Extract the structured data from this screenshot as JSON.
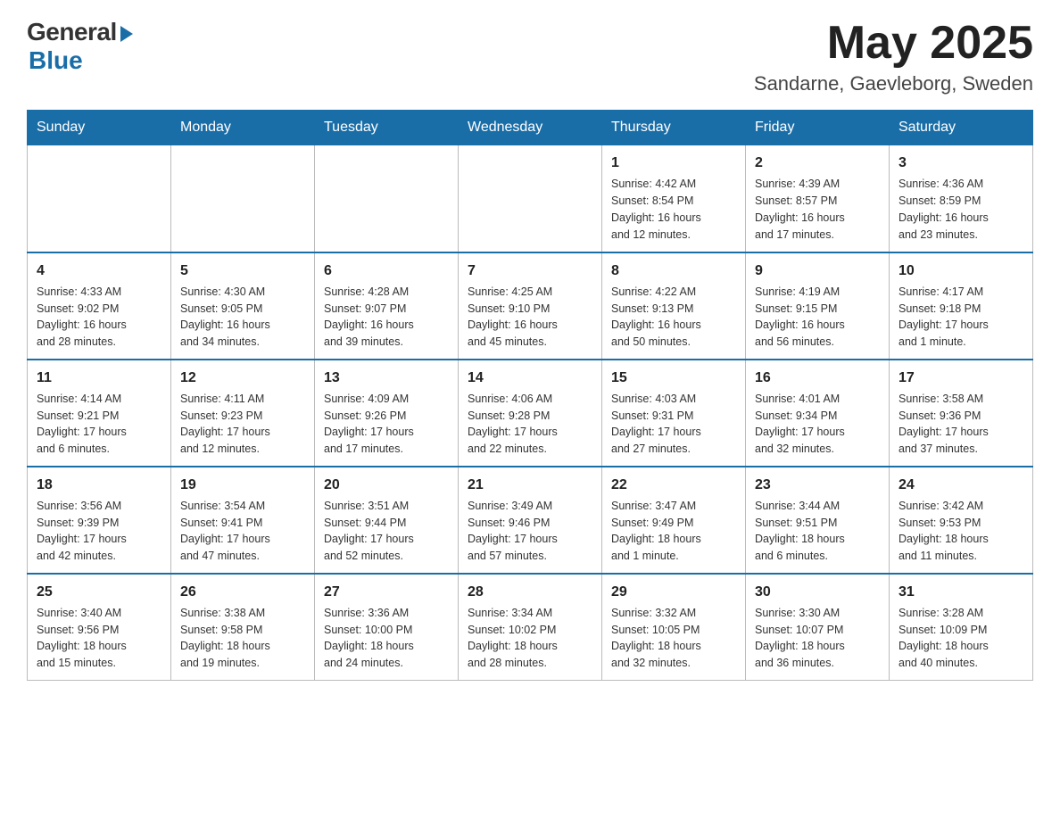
{
  "header": {
    "logo_general": "General",
    "logo_blue": "Blue",
    "month_year": "May 2025",
    "location": "Sandarne, Gaevleborg, Sweden"
  },
  "weekdays": [
    "Sunday",
    "Monday",
    "Tuesday",
    "Wednesday",
    "Thursday",
    "Friday",
    "Saturday"
  ],
  "weeks": [
    [
      {
        "day": "",
        "info": ""
      },
      {
        "day": "",
        "info": ""
      },
      {
        "day": "",
        "info": ""
      },
      {
        "day": "",
        "info": ""
      },
      {
        "day": "1",
        "info": "Sunrise: 4:42 AM\nSunset: 8:54 PM\nDaylight: 16 hours\nand 12 minutes."
      },
      {
        "day": "2",
        "info": "Sunrise: 4:39 AM\nSunset: 8:57 PM\nDaylight: 16 hours\nand 17 minutes."
      },
      {
        "day": "3",
        "info": "Sunrise: 4:36 AM\nSunset: 8:59 PM\nDaylight: 16 hours\nand 23 minutes."
      }
    ],
    [
      {
        "day": "4",
        "info": "Sunrise: 4:33 AM\nSunset: 9:02 PM\nDaylight: 16 hours\nand 28 minutes."
      },
      {
        "day": "5",
        "info": "Sunrise: 4:30 AM\nSunset: 9:05 PM\nDaylight: 16 hours\nand 34 minutes."
      },
      {
        "day": "6",
        "info": "Sunrise: 4:28 AM\nSunset: 9:07 PM\nDaylight: 16 hours\nand 39 minutes."
      },
      {
        "day": "7",
        "info": "Sunrise: 4:25 AM\nSunset: 9:10 PM\nDaylight: 16 hours\nand 45 minutes."
      },
      {
        "day": "8",
        "info": "Sunrise: 4:22 AM\nSunset: 9:13 PM\nDaylight: 16 hours\nand 50 minutes."
      },
      {
        "day": "9",
        "info": "Sunrise: 4:19 AM\nSunset: 9:15 PM\nDaylight: 16 hours\nand 56 minutes."
      },
      {
        "day": "10",
        "info": "Sunrise: 4:17 AM\nSunset: 9:18 PM\nDaylight: 17 hours\nand 1 minute."
      }
    ],
    [
      {
        "day": "11",
        "info": "Sunrise: 4:14 AM\nSunset: 9:21 PM\nDaylight: 17 hours\nand 6 minutes."
      },
      {
        "day": "12",
        "info": "Sunrise: 4:11 AM\nSunset: 9:23 PM\nDaylight: 17 hours\nand 12 minutes."
      },
      {
        "day": "13",
        "info": "Sunrise: 4:09 AM\nSunset: 9:26 PM\nDaylight: 17 hours\nand 17 minutes."
      },
      {
        "day": "14",
        "info": "Sunrise: 4:06 AM\nSunset: 9:28 PM\nDaylight: 17 hours\nand 22 minutes."
      },
      {
        "day": "15",
        "info": "Sunrise: 4:03 AM\nSunset: 9:31 PM\nDaylight: 17 hours\nand 27 minutes."
      },
      {
        "day": "16",
        "info": "Sunrise: 4:01 AM\nSunset: 9:34 PM\nDaylight: 17 hours\nand 32 minutes."
      },
      {
        "day": "17",
        "info": "Sunrise: 3:58 AM\nSunset: 9:36 PM\nDaylight: 17 hours\nand 37 minutes."
      }
    ],
    [
      {
        "day": "18",
        "info": "Sunrise: 3:56 AM\nSunset: 9:39 PM\nDaylight: 17 hours\nand 42 minutes."
      },
      {
        "day": "19",
        "info": "Sunrise: 3:54 AM\nSunset: 9:41 PM\nDaylight: 17 hours\nand 47 minutes."
      },
      {
        "day": "20",
        "info": "Sunrise: 3:51 AM\nSunset: 9:44 PM\nDaylight: 17 hours\nand 52 minutes."
      },
      {
        "day": "21",
        "info": "Sunrise: 3:49 AM\nSunset: 9:46 PM\nDaylight: 17 hours\nand 57 minutes."
      },
      {
        "day": "22",
        "info": "Sunrise: 3:47 AM\nSunset: 9:49 PM\nDaylight: 18 hours\nand 1 minute."
      },
      {
        "day": "23",
        "info": "Sunrise: 3:44 AM\nSunset: 9:51 PM\nDaylight: 18 hours\nand 6 minutes."
      },
      {
        "day": "24",
        "info": "Sunrise: 3:42 AM\nSunset: 9:53 PM\nDaylight: 18 hours\nand 11 minutes."
      }
    ],
    [
      {
        "day": "25",
        "info": "Sunrise: 3:40 AM\nSunset: 9:56 PM\nDaylight: 18 hours\nand 15 minutes."
      },
      {
        "day": "26",
        "info": "Sunrise: 3:38 AM\nSunset: 9:58 PM\nDaylight: 18 hours\nand 19 minutes."
      },
      {
        "day": "27",
        "info": "Sunrise: 3:36 AM\nSunset: 10:00 PM\nDaylight: 18 hours\nand 24 minutes."
      },
      {
        "day": "28",
        "info": "Sunrise: 3:34 AM\nSunset: 10:02 PM\nDaylight: 18 hours\nand 28 minutes."
      },
      {
        "day": "29",
        "info": "Sunrise: 3:32 AM\nSunset: 10:05 PM\nDaylight: 18 hours\nand 32 minutes."
      },
      {
        "day": "30",
        "info": "Sunrise: 3:30 AM\nSunset: 10:07 PM\nDaylight: 18 hours\nand 36 minutes."
      },
      {
        "day": "31",
        "info": "Sunrise: 3:28 AM\nSunset: 10:09 PM\nDaylight: 18 hours\nand 40 minutes."
      }
    ]
  ]
}
